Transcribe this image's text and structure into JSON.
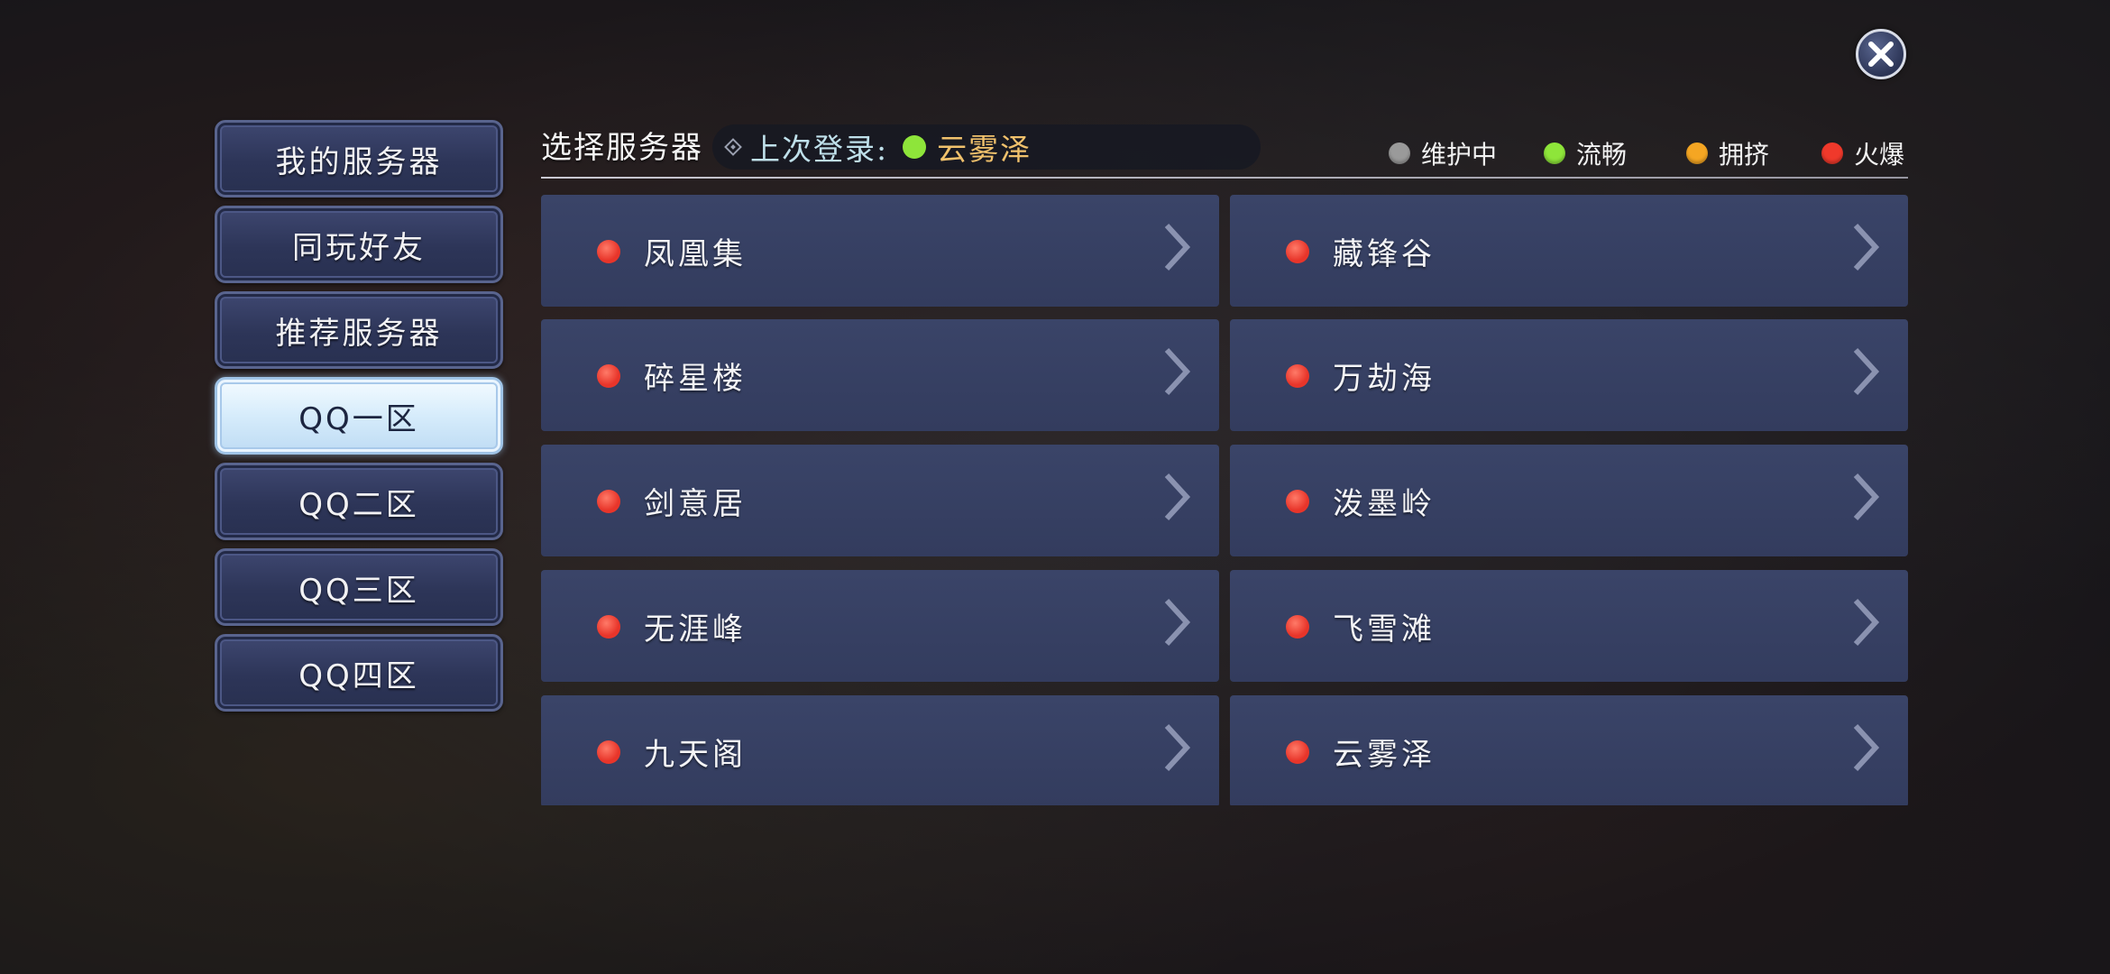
{
  "header": {
    "title": "选择服务器",
    "last_login_label": "上次登录:",
    "last_login_server": "云雾泽",
    "last_login_status_color": "#8ee53a"
  },
  "legend": [
    {
      "label": "维护中",
      "color": "#9a9a9a"
    },
    {
      "label": "流畅",
      "color": "#8ee53a"
    },
    {
      "label": "拥挤",
      "color": "#f5a623"
    },
    {
      "label": "火爆",
      "color": "#f0392b"
    }
  ],
  "sidebar": {
    "items": [
      {
        "label": "我的服务器",
        "active": false
      },
      {
        "label": "同玩好友",
        "active": false
      },
      {
        "label": "推荐服务器",
        "active": false
      },
      {
        "label": "QQ一区",
        "active": true
      },
      {
        "label": "QQ二区",
        "active": false
      },
      {
        "label": "QQ三区",
        "active": false
      },
      {
        "label": "QQ四区",
        "active": false
      }
    ]
  },
  "servers": [
    {
      "name": "凤凰集",
      "status": "火爆"
    },
    {
      "name": "藏锋谷",
      "status": "火爆"
    },
    {
      "name": "碎星楼",
      "status": "火爆"
    },
    {
      "name": "万劫海",
      "status": "火爆"
    },
    {
      "name": "剑意居",
      "status": "火爆"
    },
    {
      "name": "泼墨岭",
      "status": "火爆"
    },
    {
      "name": "无涯峰",
      "status": "火爆"
    },
    {
      "name": "飞雪滩",
      "status": "火爆"
    },
    {
      "name": "九天阁",
      "status": "火爆"
    },
    {
      "name": "云雾泽",
      "status": "火爆"
    }
  ]
}
